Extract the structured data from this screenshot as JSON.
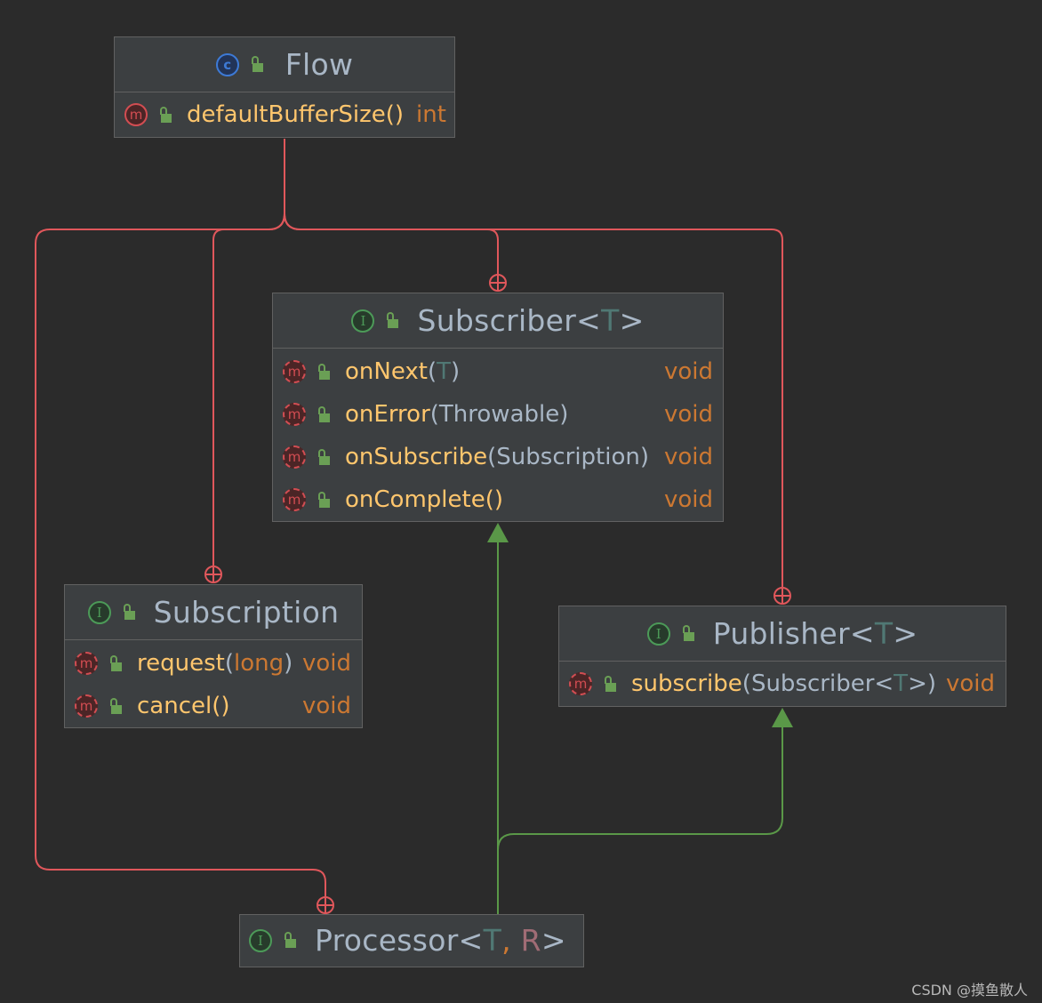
{
  "diagram": {
    "flow": {
      "name": "Flow",
      "methods": [
        {
          "name": "defaultBufferSize",
          "args": "()",
          "ret": "int"
        }
      ]
    },
    "subscriber": {
      "name": "Subscriber",
      "lt": "<",
      "type_param": "T",
      "gt": ">",
      "methods": [
        {
          "name": "onNext",
          "lp": "(",
          "arg": "T",
          "rp": ")",
          "ret": "void"
        },
        {
          "name": "onError",
          "lp": "(",
          "arg": "Throwable",
          "rp": ")",
          "ret": "void"
        },
        {
          "name": "onSubscribe",
          "lp": "(",
          "arg": "Subscription",
          "rp": ")",
          "ret": "void"
        },
        {
          "name": "onComplete",
          "lp": "()",
          "arg": "",
          "rp": "",
          "ret": "void"
        }
      ]
    },
    "subscription": {
      "name": "Subscription",
      "methods": [
        {
          "name": "request",
          "lp": "(",
          "arg": "long",
          "rp": ")",
          "ret": "void"
        },
        {
          "name": "cancel",
          "lp": "()",
          "arg": "",
          "rp": "",
          "ret": "void"
        }
      ]
    },
    "publisher": {
      "name": "Publisher",
      "lt": "<",
      "type_param": "T",
      "gt": ">",
      "methods": [
        {
          "name": "subscribe",
          "lp": "(",
          "arg1": "Subscriber<",
          "arg_tp": "T",
          "arg2": ">",
          "rp": ")",
          "ret": "void"
        }
      ]
    },
    "processor": {
      "name": "Processor",
      "lt": "<",
      "tp1": "T",
      "sep": ", ",
      "tp2": "R",
      "gt": ">"
    }
  },
  "icons": {
    "class": "class-icon",
    "interface": "interface-icon",
    "method": "method-icon",
    "abstract_method": "abstract-method-icon",
    "public": "public-lock-icon",
    "inner": "inner-class-marker-icon",
    "extends": "extends-arrow-icon"
  },
  "icon_glyphs": {
    "class": "c",
    "interface": "I",
    "method": "m"
  },
  "colors": {
    "background": "#2b2b2b",
    "box": "#3c3f41",
    "inner_edge": "#e0575b",
    "extends_edge": "#5a9848",
    "method_name": "#ffc66d",
    "return_type": "#cc7832"
  },
  "watermark": "CSDN @摸鱼散人"
}
